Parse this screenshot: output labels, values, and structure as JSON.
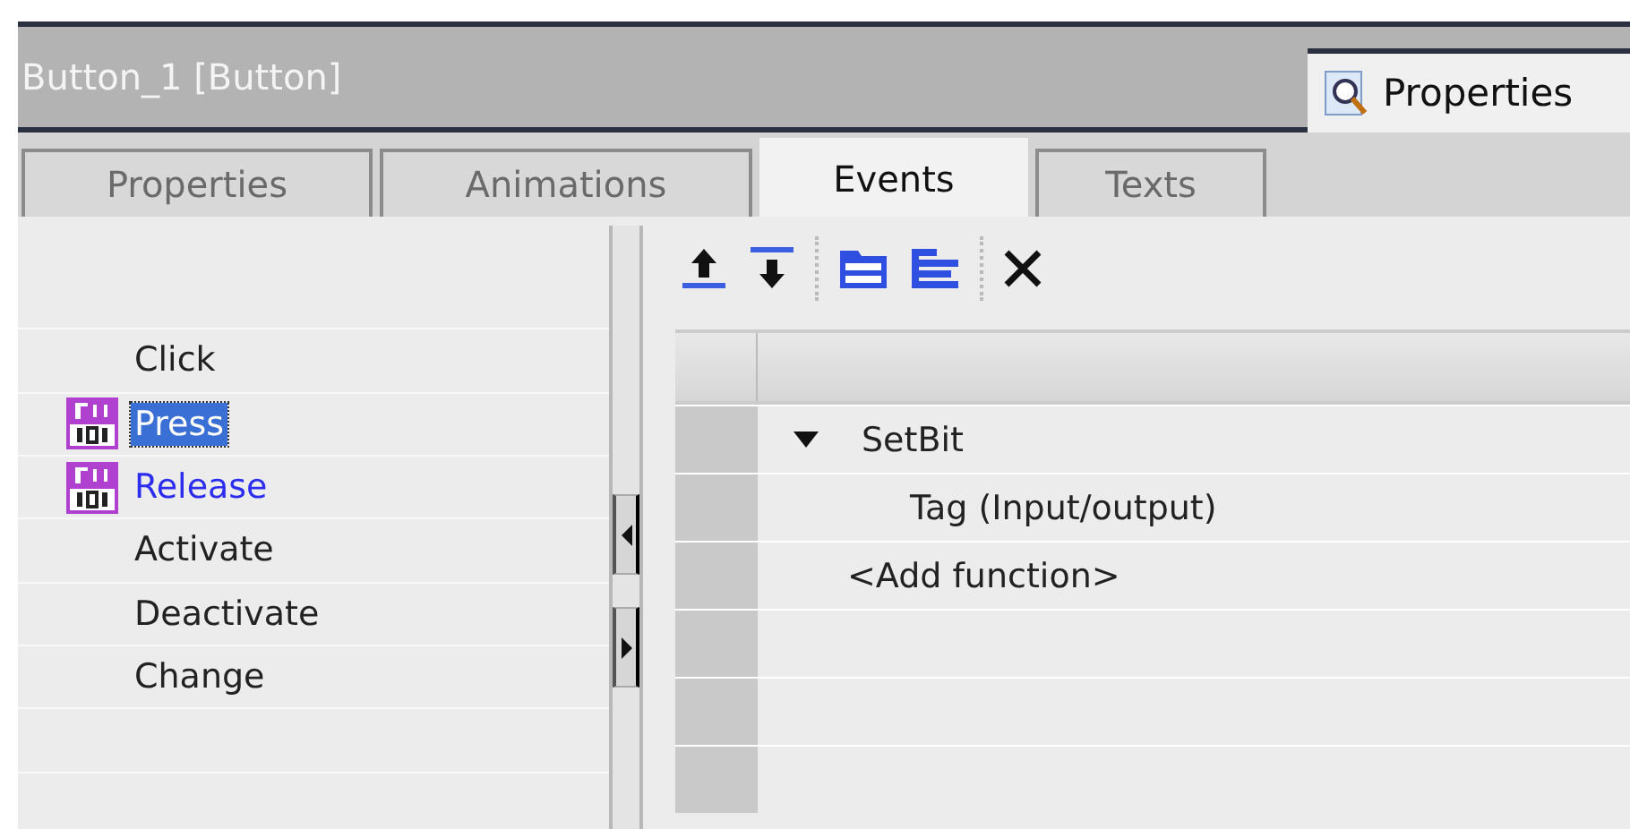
{
  "window": {
    "title": "Button_1 [Button]",
    "inspector_tab": "Properties"
  },
  "tabs": [
    {
      "label": "Properties",
      "selected": false
    },
    {
      "label": "Animations",
      "selected": false
    },
    {
      "label": "Events",
      "selected": true
    },
    {
      "label": "Texts",
      "selected": false
    }
  ],
  "events": [
    {
      "label": "Click",
      "configured": false,
      "selected": false
    },
    {
      "label": "Press",
      "configured": true,
      "selected": true
    },
    {
      "label": "Release",
      "configured": true,
      "selected": false
    },
    {
      "label": "Activate",
      "configured": false,
      "selected": false
    },
    {
      "label": "Deactivate",
      "configured": false,
      "selected": false
    },
    {
      "label": "Change",
      "configured": false,
      "selected": false
    }
  ],
  "function_list": [
    {
      "kind": "function",
      "label": "SetBit",
      "expanded": true
    },
    {
      "kind": "parameter",
      "label": "Tag (Input/output)"
    },
    {
      "kind": "add",
      "label": "<Add function>"
    }
  ]
}
